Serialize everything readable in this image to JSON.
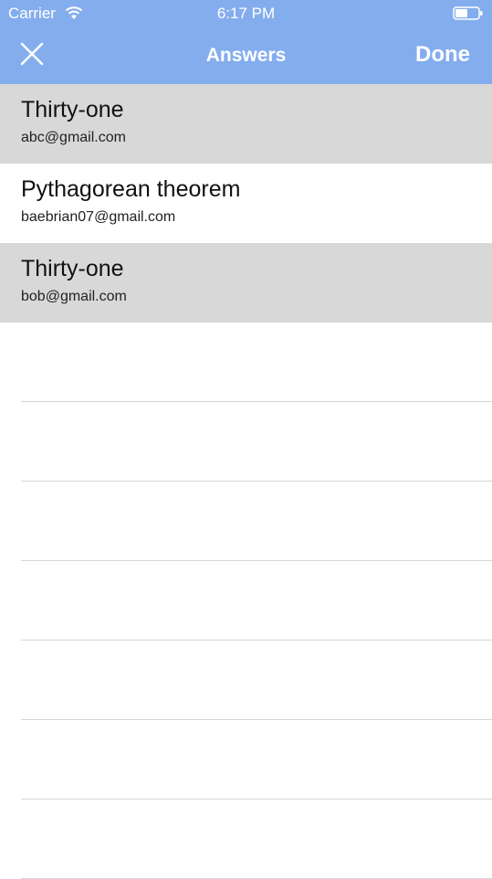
{
  "status_bar": {
    "carrier": "Carrier",
    "time": "6:17 PM",
    "wifi_icon": "wifi-icon",
    "battery_icon": "battery-icon"
  },
  "nav": {
    "title": "Answers",
    "done_label": "Done",
    "close_icon": "close-icon"
  },
  "answers": [
    {
      "answer": "Thirty-one",
      "email": "abc@gmail.com",
      "highlighted": true
    },
    {
      "answer": "Pythagorean theorem",
      "email": "baebrian07@gmail.com",
      "highlighted": false
    },
    {
      "answer": "Thirty-one",
      "email": "bob@gmail.com",
      "highlighted": true
    }
  ],
  "colors": {
    "nav_background": "#84adee",
    "highlight_row": "#d8d8d8",
    "separator": "#d6d6d6"
  }
}
